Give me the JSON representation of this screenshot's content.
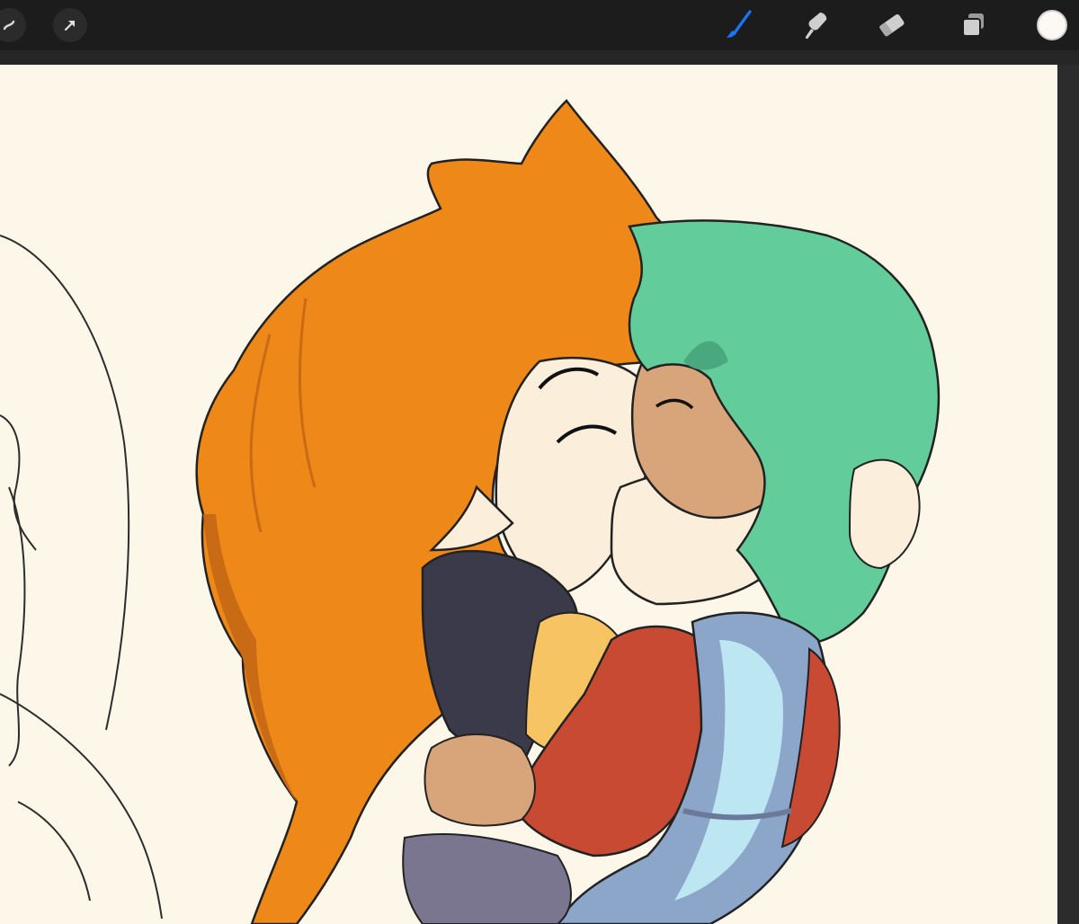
{
  "app": {
    "toolbar": {
      "left": [
        {
          "name": "modify-icon"
        },
        {
          "name": "transform-arrow-icon"
        }
      ],
      "right": [
        {
          "name": "brush-icon",
          "active": true,
          "color": "#1a74ff"
        },
        {
          "name": "smudge-icon",
          "active": false
        },
        {
          "name": "eraser-icon",
          "active": false
        },
        {
          "name": "layers-icon",
          "active": false
        }
      ],
      "current_color": "#fdf8f4"
    },
    "canvas": {
      "paper_color": "#fdf7ea",
      "colors": {
        "orange_hair": "#ee8818",
        "orange_shadow": "#c96a14",
        "green_hair": "#62cc9a",
        "skin_pale": "#fbefdc",
        "skin_tan": "#d8a47a",
        "navy": "#3a3a4a",
        "red_sleeve": "#c84a32",
        "light_blue": "#bde6f3",
        "blue_gray": "#8ba6c8",
        "yellow_cuff": "#f7c464"
      }
    }
  }
}
